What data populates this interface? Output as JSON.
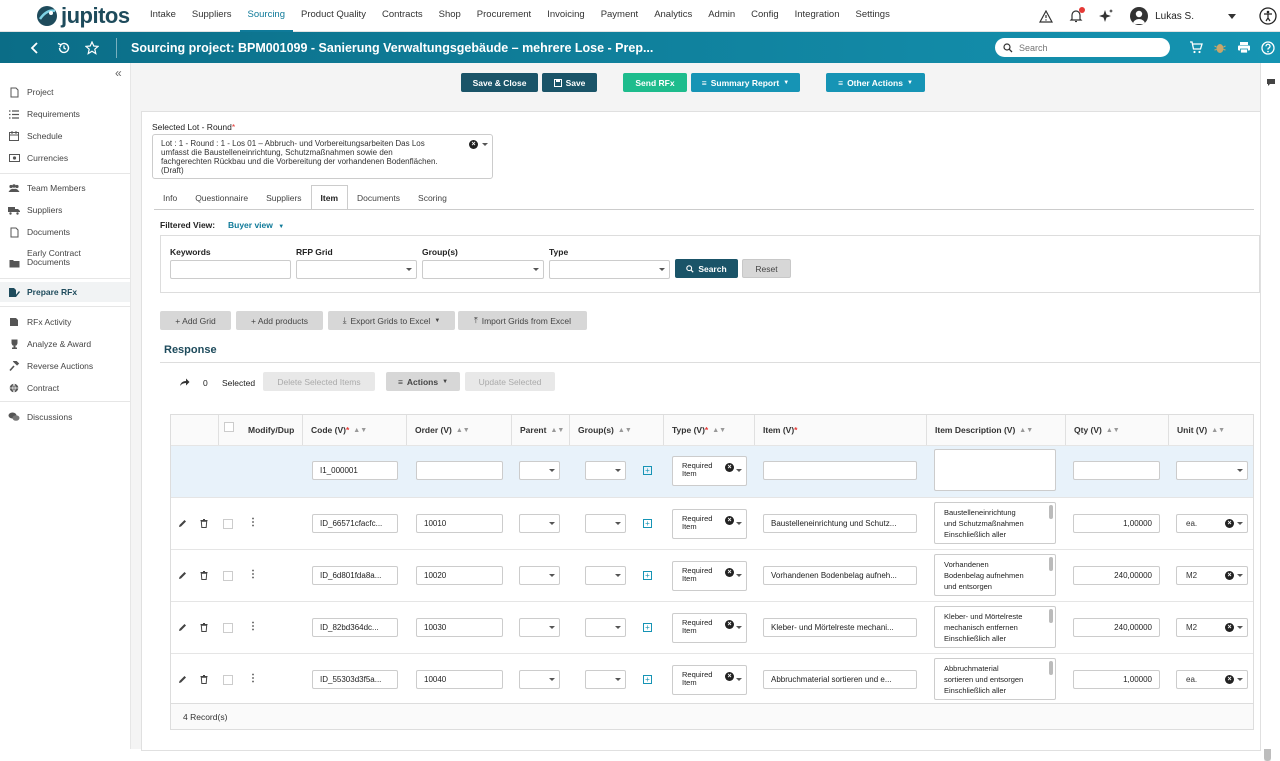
{
  "app": {
    "logo_text": "jupitos"
  },
  "nav": {
    "items": [
      "Intake",
      "Suppliers",
      "Sourcing",
      "Product Quality",
      "Contracts",
      "Shop",
      "Procurement",
      "Invoicing",
      "Payment",
      "Analytics",
      "Admin",
      "Config",
      "Integration",
      "Settings"
    ],
    "active": "Sourcing"
  },
  "user": {
    "name": "Lukas S."
  },
  "titlebar": {
    "title": "Sourcing project: BPM001099 - Sanierung Verwaltungsgebäude – mehrere Lose - Prep...",
    "search_placeholder": "Search"
  },
  "sidebar": {
    "collapse_icon": "«",
    "items": [
      {
        "label": "Project",
        "icon": "document-icon"
      },
      {
        "label": "Requirements",
        "icon": "list-icon"
      },
      {
        "label": "Schedule",
        "icon": "calendar-icon"
      },
      {
        "label": "Currencies",
        "icon": "currency-icon"
      },
      {
        "label": "Team Members",
        "icon": "team-icon"
      },
      {
        "label": "Suppliers",
        "icon": "truck-icon"
      },
      {
        "label": "Documents",
        "icon": "document-icon"
      },
      {
        "label": "Early Contract",
        "label2": "Documents",
        "icon": "folder-icon"
      },
      {
        "label": "Prepare RFx",
        "icon": "prepare-icon"
      },
      {
        "label": "RFx Activity",
        "icon": "activity-icon"
      },
      {
        "label": "Analyze & Award",
        "icon": "trophy-icon"
      },
      {
        "label": "Reverse Auctions",
        "icon": "gavel-icon"
      },
      {
        "label": "Contract",
        "icon": "globe-icon"
      },
      {
        "label": "Discussions",
        "icon": "chat-icon"
      }
    ],
    "active": "Prepare RFx"
  },
  "actions": {
    "save_close": "Save & Close",
    "save": "Save",
    "send_rfx": "Send RFx",
    "summary_report": "Summary Report",
    "other_actions": "Other Actions"
  },
  "lot": {
    "label": "Selected Lot - Round",
    "value_lines": [
      "Lot : 1 - Round : 1 - Los 01 – Abbruch- und Vorbereitungsarbeiten Das Los",
      "umfasst die Baustelleneinrichtung, Schutzmaßnahmen sowie den",
      "fachgerechten Rückbau und die Vorbereitung der vorhandenen Bodenflächen.",
      "(Draft)"
    ]
  },
  "tabs": [
    "Info",
    "Questionnaire",
    "Suppliers",
    "Item",
    "Documents",
    "Scoring"
  ],
  "active_tab": "Item",
  "filter": {
    "label": "Filtered View:",
    "value": "Buyer view",
    "keywords": "Keywords",
    "rfp_grid": "RFP Grid",
    "groups": "Group(s)",
    "type": "Type",
    "search": "Search",
    "reset": "Reset"
  },
  "grid_actions": {
    "add_grid": "+ Add Grid",
    "add_products": "+ Add products",
    "export": "Export Grids to Excel",
    "import": "Import Grids from Excel"
  },
  "response": {
    "title": "Response",
    "selected_count": "0",
    "selected_label": "Selected",
    "delete": "Delete Selected Items",
    "actions": "Actions",
    "update": "Update Selected"
  },
  "grid": {
    "columns": [
      "Modify/Dup",
      "Code (V)",
      "Order (V)",
      "Parent",
      "Group(s)",
      "Type (V)",
      "Item (V)",
      "Item Description (V)",
      "Qty (V)",
      "Unit (V)"
    ],
    "new_row": {
      "code": "I1_000001",
      "type": "Required Item"
    },
    "rows": [
      {
        "code": "ID_66571cfacfc...",
        "order": "10010",
        "type": "Required Item",
        "item": "Baustelleneinrichtung und Schutz...",
        "desc": [
          "Baustelleneinrichtung",
          "und Schutzmaßnahmen",
          "Einschließlich aller"
        ],
        "qty": "1,00000",
        "unit": "ea."
      },
      {
        "code": "ID_6d801fda8a...",
        "order": "10020",
        "type": "Required Item",
        "item": "Vorhandenen Bodenbelag aufneh...",
        "desc": [
          "Vorhandenen",
          "Bodenbelag aufnehmen",
          "und entsorgen"
        ],
        "qty": "240,00000",
        "unit": "M2"
      },
      {
        "code": "ID_82bd364dc...",
        "order": "10030",
        "type": "Required Item",
        "item": "Kleber- und Mörtelreste mechani...",
        "desc": [
          "Kleber- und Mörtelreste",
          "mechanisch entfernen",
          "Einschließlich aller"
        ],
        "qty": "240,00000",
        "unit": "M2"
      },
      {
        "code": "ID_55303d3f5a...",
        "order": "10040",
        "type": "Required Item",
        "item": "Abbruchmaterial sortieren und e...",
        "desc": [
          "Abbruchmaterial",
          "sortieren und entsorgen",
          "Einschließlich aller"
        ],
        "qty": "1,00000",
        "unit": "ea."
      }
    ],
    "records": "4 Record(s)"
  },
  "colors": {
    "brand": "#1e4b5c",
    "accent": "#0f7a99",
    "green": "#1ebc8d",
    "teal": "#1694b5"
  }
}
